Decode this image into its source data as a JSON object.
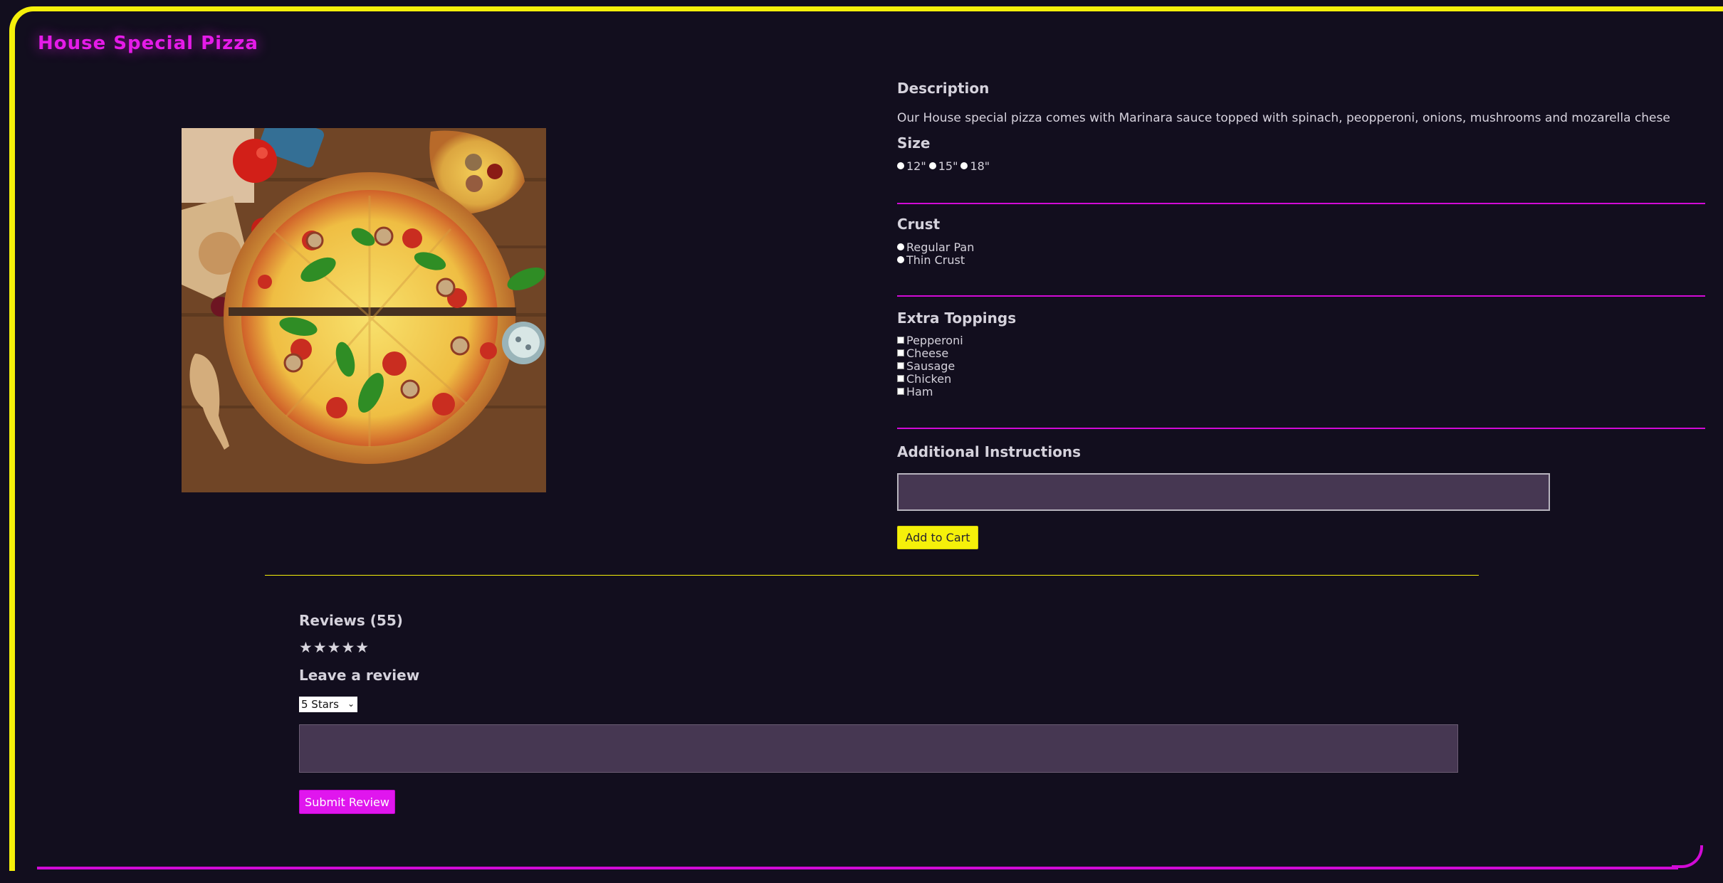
{
  "brand": "House Special Pizza",
  "product": {
    "description_heading": "Description",
    "description": "Our House special pizza comes with Marinara sauce topped with spinach, peopperoni, onions, mushrooms and mozarella chese",
    "size_heading": "Size",
    "sizes": [
      "12\"",
      "15\"",
      "18\""
    ],
    "crust_heading": "Crust",
    "crusts": [
      "Regular Pan",
      "Thin Crust"
    ],
    "toppings_heading": "Extra Toppings",
    "toppings": [
      "Pepperoni",
      "Cheese",
      "Sausage",
      "Chicken",
      "Ham"
    ],
    "instructions_heading": "Additional Instructions",
    "instructions_value": "",
    "add_to_cart": "Add to Cart"
  },
  "reviews": {
    "heading": "Reviews (55)",
    "rating": 5,
    "stars": "★★★★★",
    "leave_review_heading": "Leave a review",
    "selected_rating": "5 Stars",
    "review_text": "",
    "submit_label": "Submit Review"
  },
  "colors": {
    "background": "#120e1e",
    "frame": "#f5f00a",
    "accent": "#d10ad6",
    "input_fill": "#463752"
  },
  "icons": {
    "star": "star-icon",
    "select_arrow": "chevron-down-icon"
  }
}
